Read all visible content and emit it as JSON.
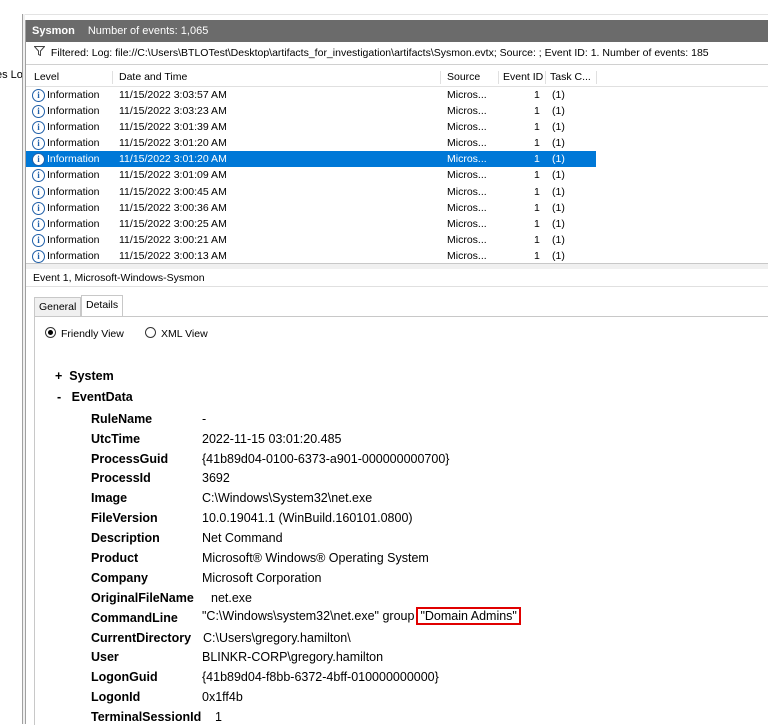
{
  "left_pane": {
    "clipped_label": "es Lo"
  },
  "title_bar": {
    "log_name": "Sysmon",
    "event_count": "Number of events: 1,065"
  },
  "filter_bar": {
    "icon": "filter-icon",
    "text": "Filtered: Log: file://C:\\Users\\BTLOTest\\Desktop\\artifacts_for_investigation\\artifacts\\Sysmon.evtx; Source: ; Event ID: 1. Number of events: 185"
  },
  "columns": {
    "level": "Level",
    "date_time": "Date and Time",
    "source": "Source",
    "event_id": "Event ID",
    "task": "Task C..."
  },
  "events": [
    {
      "level": "Information",
      "date_time": "11/15/2022 3:03:57 AM",
      "source": "Micros...",
      "event_id": "1",
      "task": "(1)"
    },
    {
      "level": "Information",
      "date_time": "11/15/2022 3:03:23 AM",
      "source": "Micros...",
      "event_id": "1",
      "task": "(1)"
    },
    {
      "level": "Information",
      "date_time": "11/15/2022 3:01:39 AM",
      "source": "Micros...",
      "event_id": "1",
      "task": "(1)"
    },
    {
      "level": "Information",
      "date_time": "11/15/2022 3:01:20 AM",
      "source": "Micros...",
      "event_id": "1",
      "task": "(1)"
    },
    {
      "level": "Information",
      "date_time": "11/15/2022 3:01:20 AM",
      "source": "Micros...",
      "event_id": "1",
      "task": "(1)"
    },
    {
      "level": "Information",
      "date_time": "11/15/2022 3:01:09 AM",
      "source": "Micros...",
      "event_id": "1",
      "task": "(1)"
    },
    {
      "level": "Information",
      "date_time": "11/15/2022 3:00:45 AM",
      "source": "Micros...",
      "event_id": "1",
      "task": "(1)"
    },
    {
      "level": "Information",
      "date_time": "11/15/2022 3:00:36 AM",
      "source": "Micros...",
      "event_id": "1",
      "task": "(1)"
    },
    {
      "level": "Information",
      "date_time": "11/15/2022 3:00:25 AM",
      "source": "Micros...",
      "event_id": "1",
      "task": "(1)"
    },
    {
      "level": "Information",
      "date_time": "11/15/2022 3:00:21 AM",
      "source": "Micros...",
      "event_id": "1",
      "task": "(1)"
    },
    {
      "level": "Information",
      "date_time": "11/15/2022 3:00:13 AM",
      "source": "Micros...",
      "event_id": "1",
      "task": "(1)"
    }
  ],
  "selected_index": 4,
  "event_title": "Event 1, Microsoft-Windows-Sysmon",
  "tabs": {
    "general": "General",
    "details": "Details"
  },
  "view_options": {
    "friendly": "Friendly View",
    "xml": "XML View",
    "selected": "friendly"
  },
  "tree": {
    "system_toggle": "+",
    "system_label": "System",
    "eventdata_toggle": "-",
    "eventdata_label": "EventData"
  },
  "event_data": {
    "rulename": {
      "name": "RuleName",
      "value": "-"
    },
    "utctime": {
      "name": "UtcTime",
      "value": "2022-11-15 03:01:20.485"
    },
    "processguid": {
      "name": "ProcessGuid",
      "value": "{41b89d04-0100-6373-a901-000000000700}"
    },
    "processid": {
      "name": "ProcessId",
      "value": "3692"
    },
    "image": {
      "name": "Image",
      "value": "C:\\Windows\\System32\\net.exe"
    },
    "fileversion": {
      "name": "FileVersion",
      "value": "10.0.19041.1 (WinBuild.160101.0800)"
    },
    "description": {
      "name": "Description",
      "value": "Net Command"
    },
    "product": {
      "name": "Product",
      "value": "Microsoft® Windows® Operating System"
    },
    "company": {
      "name": "Company",
      "value": "Microsoft Corporation"
    },
    "originalfilename": {
      "name": "OriginalFileName",
      "value": "net.exe"
    },
    "commandline": {
      "name": "CommandLine",
      "value_prefix": "\"C:\\Windows\\system32\\net.exe\" group",
      "value_highlight": "\"Domain Admins\""
    },
    "currentdirectory": {
      "name": "CurrentDirectory",
      "value": "C:\\Users\\gregory.hamilton\\"
    },
    "user": {
      "name": "User",
      "value": "BLINKR-CORP\\gregory.hamilton"
    },
    "logonguid": {
      "name": "LogonGuid",
      "value": "{41b89d04-f8bb-6372-4bff-010000000000}"
    },
    "logonid": {
      "name": "LogonId",
      "value": "0x1ff4b"
    },
    "terminalsessionid": {
      "name": "TerminalSessionId",
      "value": "1"
    }
  },
  "colors": {
    "title_bar": "#6b6b6b",
    "selection": "#0078d7",
    "highlight_border": "#e00000"
  }
}
